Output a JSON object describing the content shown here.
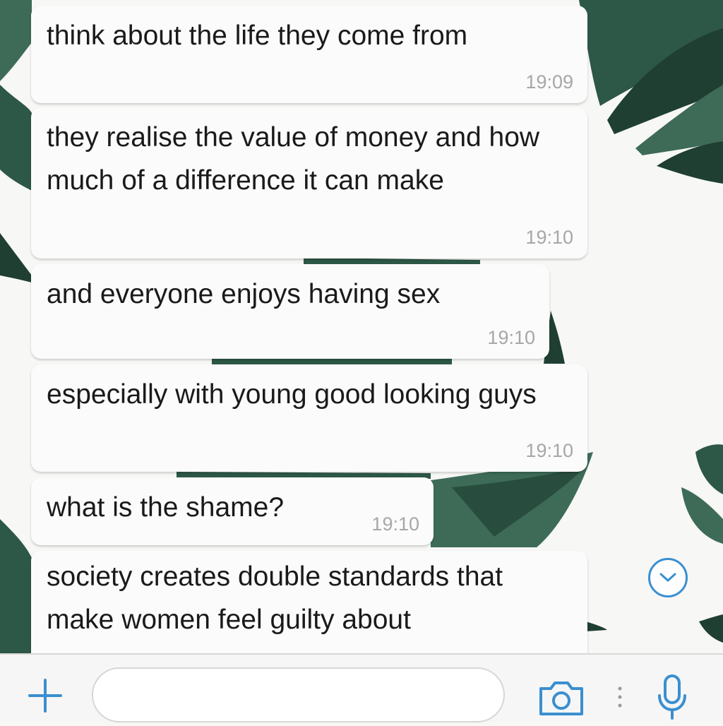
{
  "messages": [
    {
      "text": "think about the life they come from",
      "time": "19:09"
    },
    {
      "text": "they realise the value of money and how much of a difference it can make",
      "time": "19:10"
    },
    {
      "text": "and everyone enjoys having sex",
      "time": "19:10"
    },
    {
      "text": "especially with young good looking guys",
      "time": "19:10"
    },
    {
      "text": "what is the shame?",
      "time": "19:10"
    },
    {
      "text": "society creates double standards that make women feel guilty about",
      "time": ""
    }
  ],
  "composer": {
    "input_value": "",
    "icons": [
      "plus-icon",
      "camera-icon",
      "microphone-icon"
    ]
  },
  "scroll_button_icon": "chevron-down-icon",
  "colors": {
    "accent": "#3a8fd0",
    "bubble": "#fbfbfb",
    "timestamp": "#a7a7a7",
    "leaf_dark": "#1f3f33",
    "leaf_mid": "#3d6b57"
  }
}
